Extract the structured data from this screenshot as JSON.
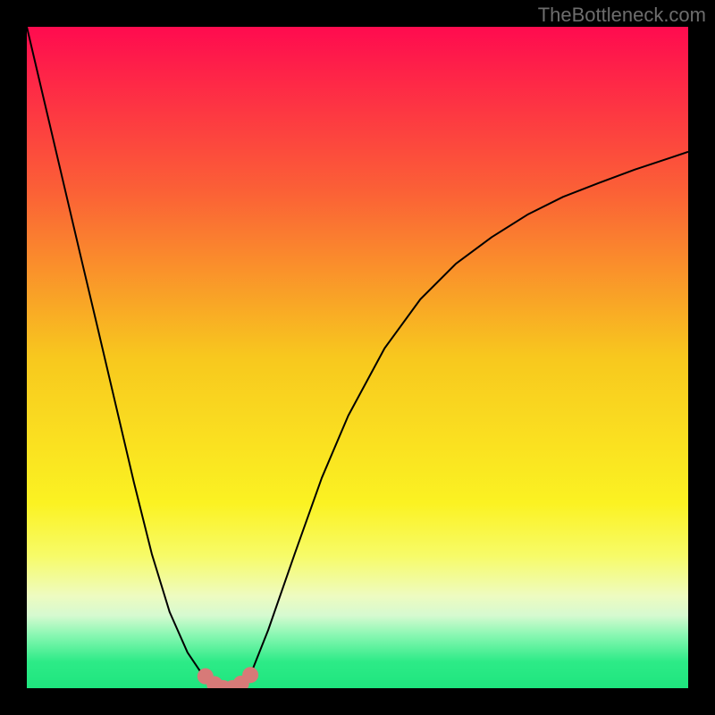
{
  "attribution": "TheBottleneck.com",
  "chart_data": {
    "type": "line",
    "title": "",
    "xlabel": "",
    "ylabel": "",
    "xlim": [
      0,
      100
    ],
    "ylim": [
      0,
      100
    ],
    "grid": false,
    "legend": false,
    "gradient_stops": [
      {
        "pos": 0.0,
        "color": "#ff0b4f"
      },
      {
        "pos": 0.25,
        "color": "#fb6136"
      },
      {
        "pos": 0.5,
        "color": "#f8c81e"
      },
      {
        "pos": 0.72,
        "color": "#fbf222"
      },
      {
        "pos": 0.8,
        "color": "#f7fb68"
      },
      {
        "pos": 0.86,
        "color": "#eefbc0"
      },
      {
        "pos": 0.89,
        "color": "#d6fad0"
      },
      {
        "pos": 0.92,
        "color": "#88f7b2"
      },
      {
        "pos": 0.96,
        "color": "#2deb87"
      },
      {
        "pos": 1.0,
        "color": "#1ee57e"
      }
    ],
    "series": [
      {
        "name": "bottleneck-curve",
        "stroke": "#000000",
        "stroke_width": 2,
        "x": [
          0.0,
          2.7,
          5.4,
          8.1,
          10.8,
          13.5,
          16.2,
          18.9,
          21.6,
          24.3,
          27.0,
          28.4,
          29.7,
          31.1,
          32.4,
          33.8,
          36.5,
          40.5,
          44.6,
          48.6,
          54.1,
          59.5,
          64.9,
          70.3,
          75.7,
          81.1,
          86.5,
          91.9,
          97.3,
          100.0
        ],
        "values": [
          100.0,
          88.5,
          77.0,
          65.5,
          54.1,
          42.6,
          31.1,
          20.3,
          11.5,
          5.4,
          1.4,
          0.4,
          0.0,
          0.0,
          0.4,
          2.0,
          8.8,
          20.3,
          31.8,
          41.2,
          51.4,
          58.8,
          64.2,
          68.2,
          71.6,
          74.3,
          76.4,
          78.4,
          80.2,
          81.1
        ]
      }
    ],
    "markers": {
      "name": "highlighted-points",
      "fill": "#d77a78",
      "radius_px": 9,
      "x": [
        27.0,
        28.4,
        29.1,
        29.7,
        31.1,
        32.4,
        33.8
      ],
      "values": [
        1.8,
        0.6,
        0.1,
        0.0,
        0.0,
        0.7,
        2.0
      ]
    }
  }
}
